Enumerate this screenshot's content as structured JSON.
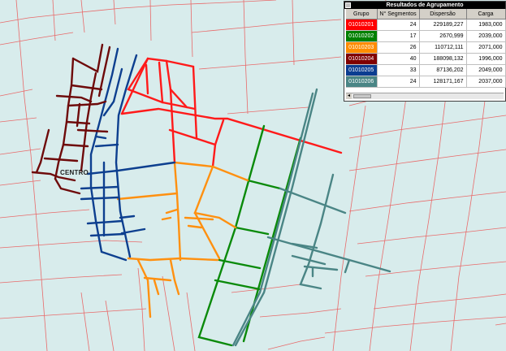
{
  "map": {
    "background": "#d8ecec",
    "parcel_line_color": "#e86a6a",
    "centro_label": "CENTRO"
  },
  "results_window": {
    "title": "Resultados de Agrupamento",
    "columns": [
      "Grupo",
      "N° Segmentos",
      "Dispersão",
      "Carga"
    ],
    "rows": [
      {
        "grupo": "01010201",
        "segmentos": "24",
        "dispersao": "229189,227",
        "carga": "1983,000",
        "color": "#ff0000"
      },
      {
        "grupo": "01010202",
        "segmentos": "17",
        "dispersao": "2670,999",
        "carga": "2039,000",
        "color": "#008000"
      },
      {
        "grupo": "01010203",
        "segmentos": "26",
        "dispersao": "110712,111",
        "carga": "2071,000",
        "color": "#ff8c00"
      },
      {
        "grupo": "01010204",
        "segmentos": "40",
        "dispersao": "188098,132",
        "carga": "1996,000",
        "color": "#800000"
      },
      {
        "grupo": "01010205",
        "segmentos": "33",
        "dispersao": "87136,202",
        "carga": "2049,000",
        "color": "#0b3d91"
      },
      {
        "grupo": "01010206",
        "segmentos": "24",
        "dispersao": "128171,167",
        "carga": "2037,000",
        "color": "#4a8585"
      }
    ]
  },
  "groups": {
    "red": "#ff1a1a",
    "green": "#0a8a0a",
    "orange": "#ff9010",
    "maroon": "#6e0a0a",
    "blue": "#0d3f8f",
    "teal": "#4a8585"
  }
}
